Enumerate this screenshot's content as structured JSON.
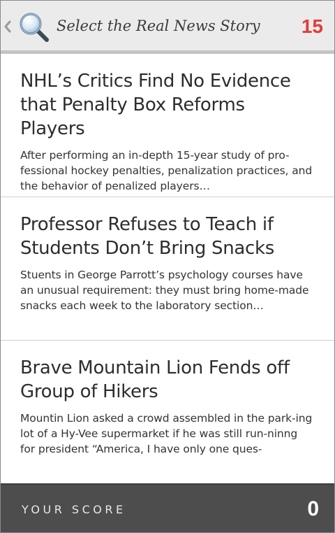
{
  "header": {
    "back_icon": "chevron-left-icon",
    "search_icon": "magnifier-icon",
    "title": "Select the Real News Story",
    "count": "15"
  },
  "stories": [
    {
      "title": "NHL’s Critics Find No Evidence that Penalty Box Reforms Players",
      "summary": "After performing an in-depth 15-year study of pro-fessional hockey penalties, penalization practices, and the behavior of penalized players…"
    },
    {
      "title": "Professor Refuses to Teach if Students Don’t Bring Snacks",
      "summary": "Stuents in George Parrott’s psychology courses have an unusual requirement: they must bring home-made snacks each week to the laboratory section…"
    },
    {
      "title": "Brave Mountain Lion Fends off Group of Hikers",
      "summary": "Mountin Lion asked a crowd assembled in the park-ing lot of a Hy-Vee supermarket if he was still run-ninng for president “America, I have only one ques-"
    }
  ],
  "footer": {
    "score_label": "YOUR SCORE",
    "score_value": "0"
  },
  "colors": {
    "header_bg": "#ebebeb",
    "count_red": "#e23b3b",
    "footer_bg": "#4d4d4d"
  }
}
